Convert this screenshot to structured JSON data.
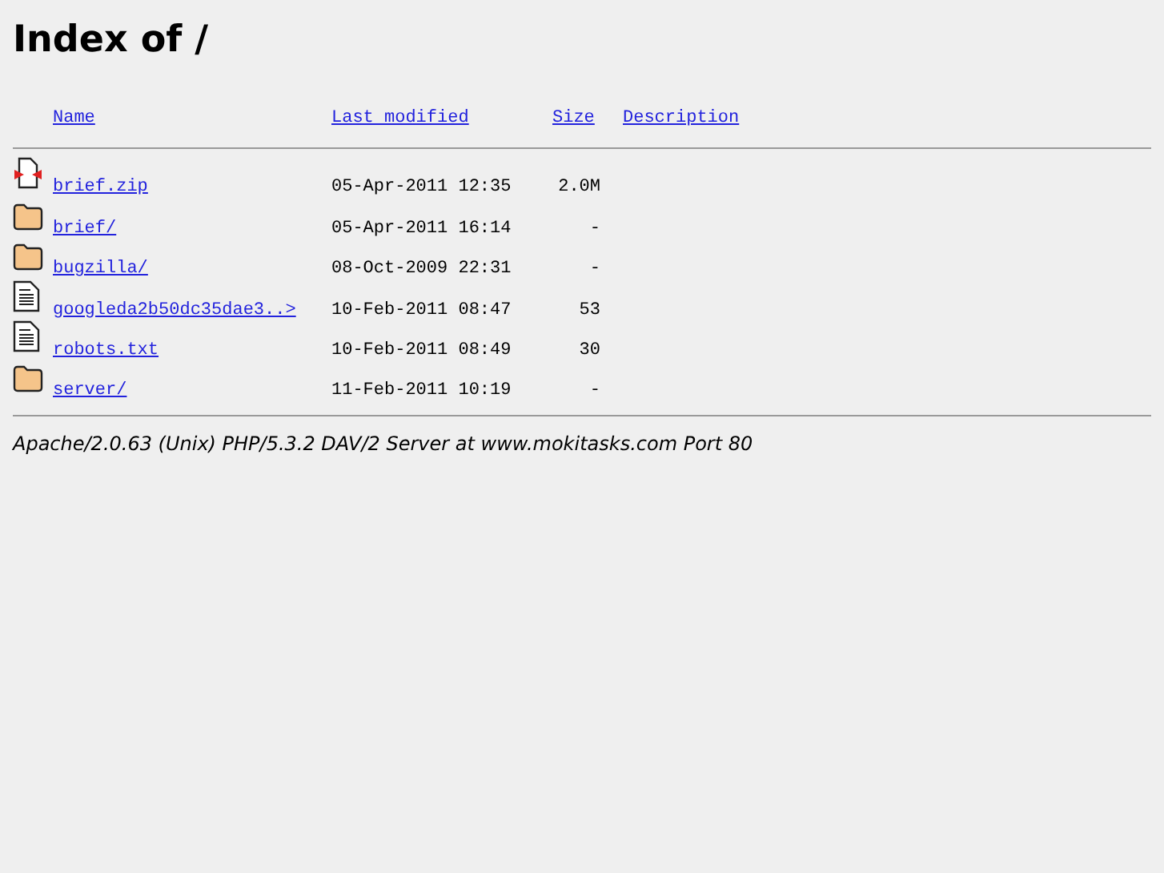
{
  "title": "Index of /",
  "columns": [
    "Name",
    "Last modified",
    "Size",
    "Description"
  ],
  "rows": [
    {
      "kind": "archive",
      "name": "brief.zip",
      "modified": "05-Apr-2011 12:35",
      "size": "2.0M"
    },
    {
      "kind": "folder",
      "name": "brief/",
      "modified": "05-Apr-2011 16:14",
      "size": "-"
    },
    {
      "kind": "folder",
      "name": "bugzilla/",
      "modified": "08-Oct-2009 22:31",
      "size": "-"
    },
    {
      "kind": "text",
      "name": "googleda2b50dc35dae3..>",
      "modified": "10-Feb-2011 08:47",
      "size": "53"
    },
    {
      "kind": "text",
      "name": "robots.txt",
      "modified": "10-Feb-2011 08:49",
      "size": "30"
    },
    {
      "kind": "folder",
      "name": "server/",
      "modified": "11-Feb-2011 10:19",
      "size": "-"
    }
  ],
  "footer": "Apache/2.0.63 (Unix) PHP/5.3.2 DAV/2 Server at www.mokitasks.com Port 80"
}
